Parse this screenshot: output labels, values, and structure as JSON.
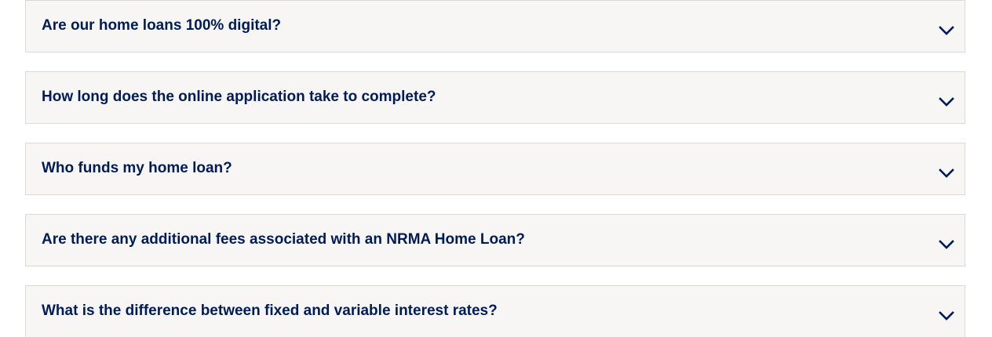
{
  "faq": {
    "items": [
      {
        "question": "Are our home loans 100% digital?",
        "icon": "chevron-down-icon"
      },
      {
        "question": "How long does the online application take to complete?",
        "icon": "chevron-down-icon"
      },
      {
        "question": "Who funds my home loan?",
        "icon": "chevron-down-icon"
      },
      {
        "question": "Are there any additional fees associated with an NRMA Home Loan?",
        "icon": "chevron-down-icon"
      },
      {
        "question": "What is the difference between fixed and variable interest rates?",
        "icon": "chevron-down-icon"
      }
    ]
  },
  "colors": {
    "question_text": "#001c58",
    "panel_background": "#f7f6f4",
    "panel_border": "#d9d9d9",
    "icon": "#001c58"
  }
}
